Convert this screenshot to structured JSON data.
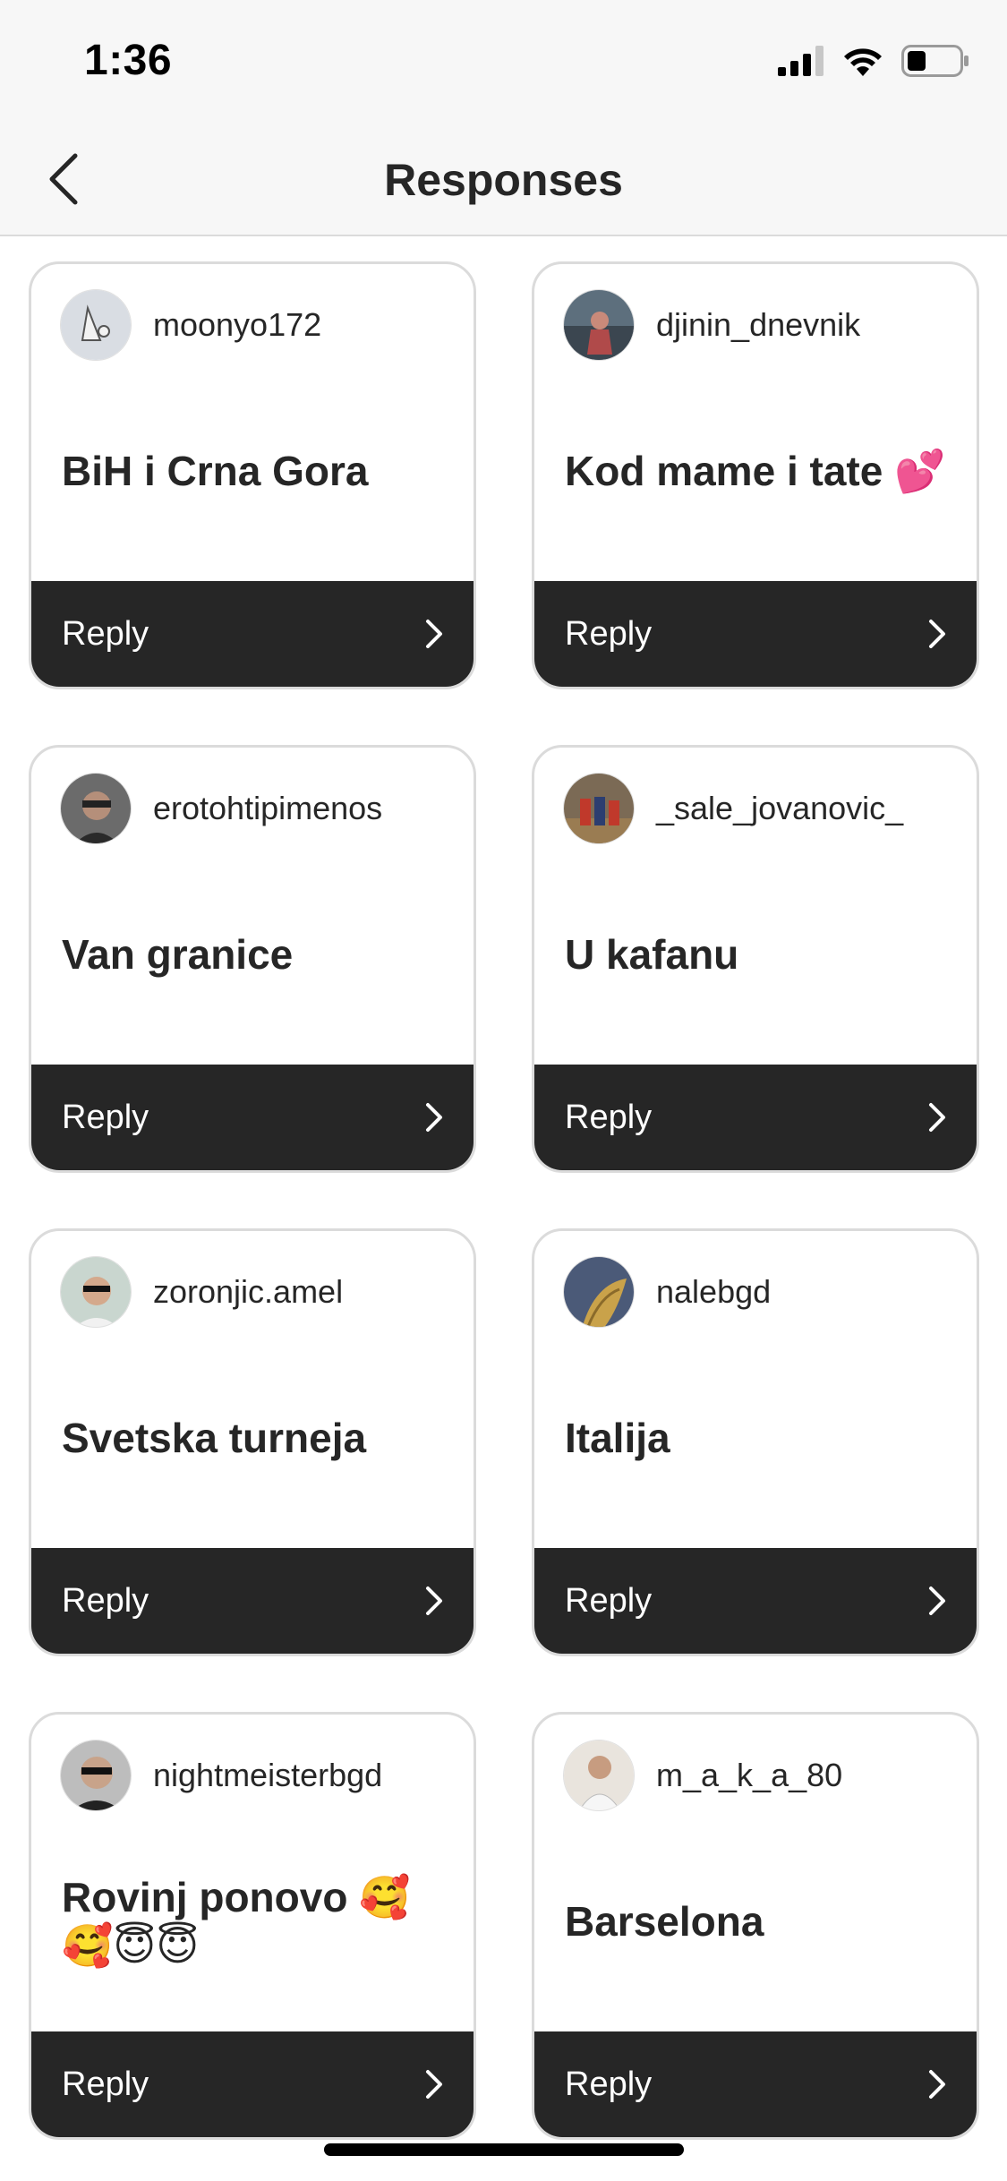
{
  "status": {
    "time": "1:36"
  },
  "header": {
    "title": "Responses"
  },
  "icons": {
    "back": "chevron-left-icon",
    "reply_arrow": "chevron-right-icon"
  },
  "colors": {
    "reply_bar": "#262626",
    "card_border": "#dbdbdb",
    "text": "#262626"
  },
  "responses": [
    {
      "username": "moonyo172",
      "answer": "BiH i Crna Gora",
      "reply": "Reply"
    },
    {
      "username": "djinin_dnevnik",
      "answer": "Kod mame i tate 💕",
      "reply": "Reply"
    },
    {
      "username": "erotohtipimenos",
      "answer": "Van granice",
      "reply": "Reply"
    },
    {
      "username": "_sale_jovanovic_",
      "answer": "U kafanu",
      "reply": "Reply"
    },
    {
      "username": "zoronjic.amel",
      "answer": "Svetska turneja",
      "reply": "Reply"
    },
    {
      "username": "nalebgd",
      "answer": "Italija",
      "reply": "Reply"
    },
    {
      "username": "nightmeisterbgd",
      "answer": "Rovinj ponovo 🥰🥰😇😇",
      "reply": "Reply"
    },
    {
      "username": "m_a_k_a_80",
      "answer": "Barselona",
      "reply": "Reply"
    }
  ]
}
